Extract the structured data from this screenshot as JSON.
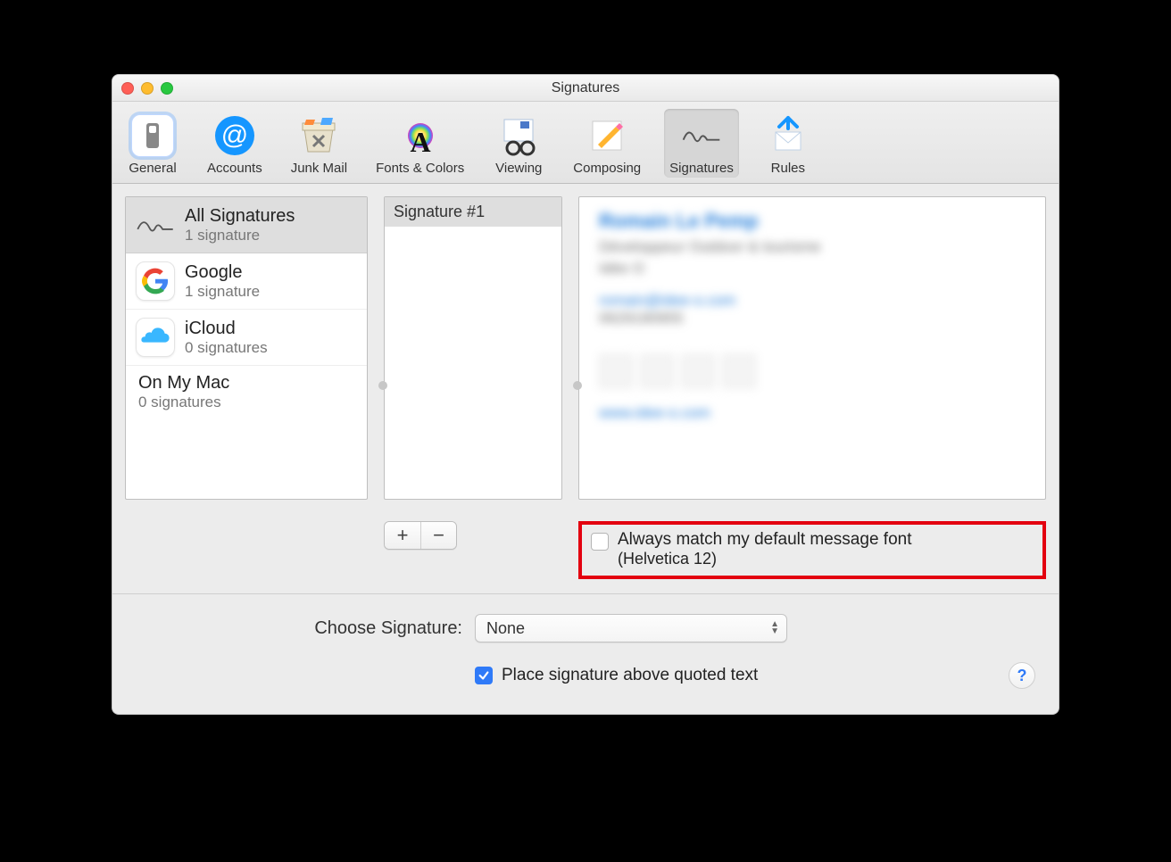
{
  "window": {
    "title": "Signatures"
  },
  "toolbar": {
    "tabs": [
      {
        "label": "General"
      },
      {
        "label": "Accounts"
      },
      {
        "label": "Junk Mail"
      },
      {
        "label": "Fonts & Colors"
      },
      {
        "label": "Viewing"
      },
      {
        "label": "Composing"
      },
      {
        "label": "Signatures"
      },
      {
        "label": "Rules"
      }
    ],
    "selected_index": 6
  },
  "accounts": [
    {
      "name": "All Signatures",
      "sub": "1 signature",
      "icon": "signature"
    },
    {
      "name": "Google",
      "sub": "1 signature",
      "icon": "google"
    },
    {
      "name": "iCloud",
      "sub": "0 signatures",
      "icon": "icloud"
    },
    {
      "name": "On My Mac",
      "sub": "0 signatures",
      "icon": null
    }
  ],
  "signatures": {
    "items": [
      "Signature #1"
    ],
    "selected_index": 0
  },
  "preview": {
    "name_line": "Romain Le Pemp",
    "role_line": "Développeur Outdoor & tourisme",
    "org_line": "Idée O",
    "email_line": "romain@idee-o.com",
    "phone_line": "0629190955",
    "url_line": "www.idee-o.com"
  },
  "match_font": {
    "checked": false,
    "line1": "Always match my default message font",
    "line2": "(Helvetica 12)"
  },
  "footer": {
    "choose_label": "Choose Signature:",
    "choose_value": "None",
    "place_above_checked": true,
    "place_above_label": "Place signature above quoted text",
    "help_symbol": "?"
  },
  "highlight_color": "#e3000f"
}
